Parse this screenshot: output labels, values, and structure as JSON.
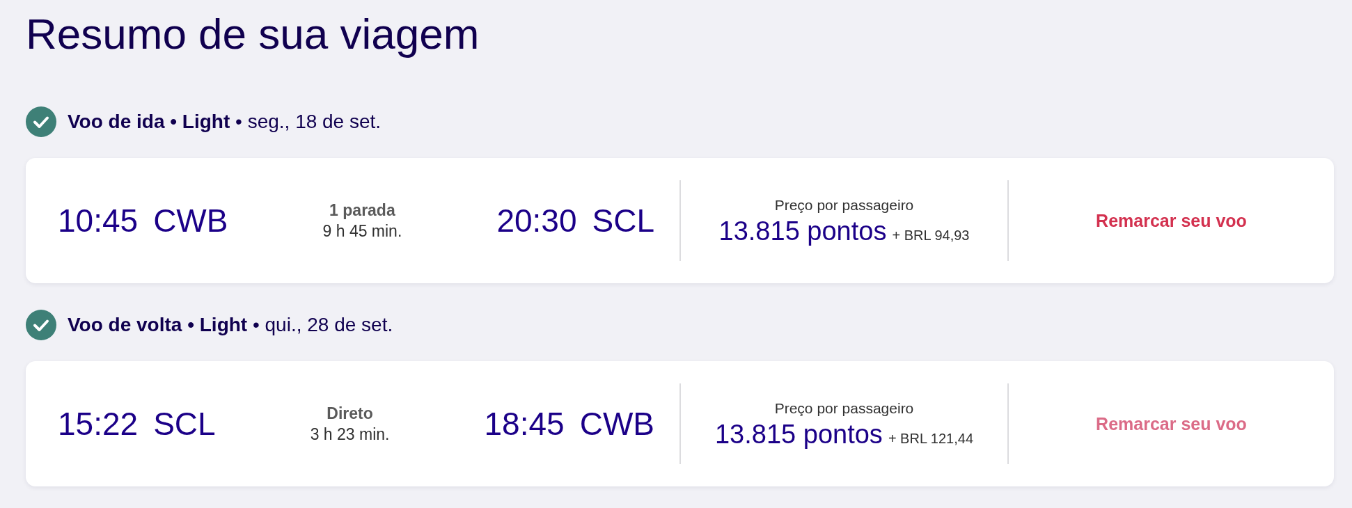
{
  "title": "Resumo de sua viagem",
  "flights": [
    {
      "confirmed": true,
      "heading": "**Voo de ida • Light** • seg., 18 de set.",
      "departure": {
        "time": "10:45",
        "airport": "CWB"
      },
      "stops": "1 parada",
      "duration": "9 h 45 min.",
      "arrival": {
        "time": "20:30",
        "airport": "SCL"
      },
      "price_label": "Preço por passageiro",
      "points": "13.815 pontos",
      "cash": "+ BRL 94,93",
      "action": {
        "label": "Remarcar seu voo",
        "disabled": false
      }
    },
    {
      "confirmed": true,
      "heading": "**Voo de volta • Light** • qui., 28 de set.",
      "departure": {
        "time": "15:22",
        "airport": "SCL"
      },
      "stops": "Direto",
      "duration": "3 h 23 min.",
      "arrival": {
        "time": "18:45",
        "airport": "CWB"
      },
      "price_label": "Preço por passageiro",
      "points": "13.815 pontos",
      "cash": "+ BRL 121,44",
      "action": {
        "label": "Remarcar seu voo",
        "disabled": true
      }
    }
  ]
}
